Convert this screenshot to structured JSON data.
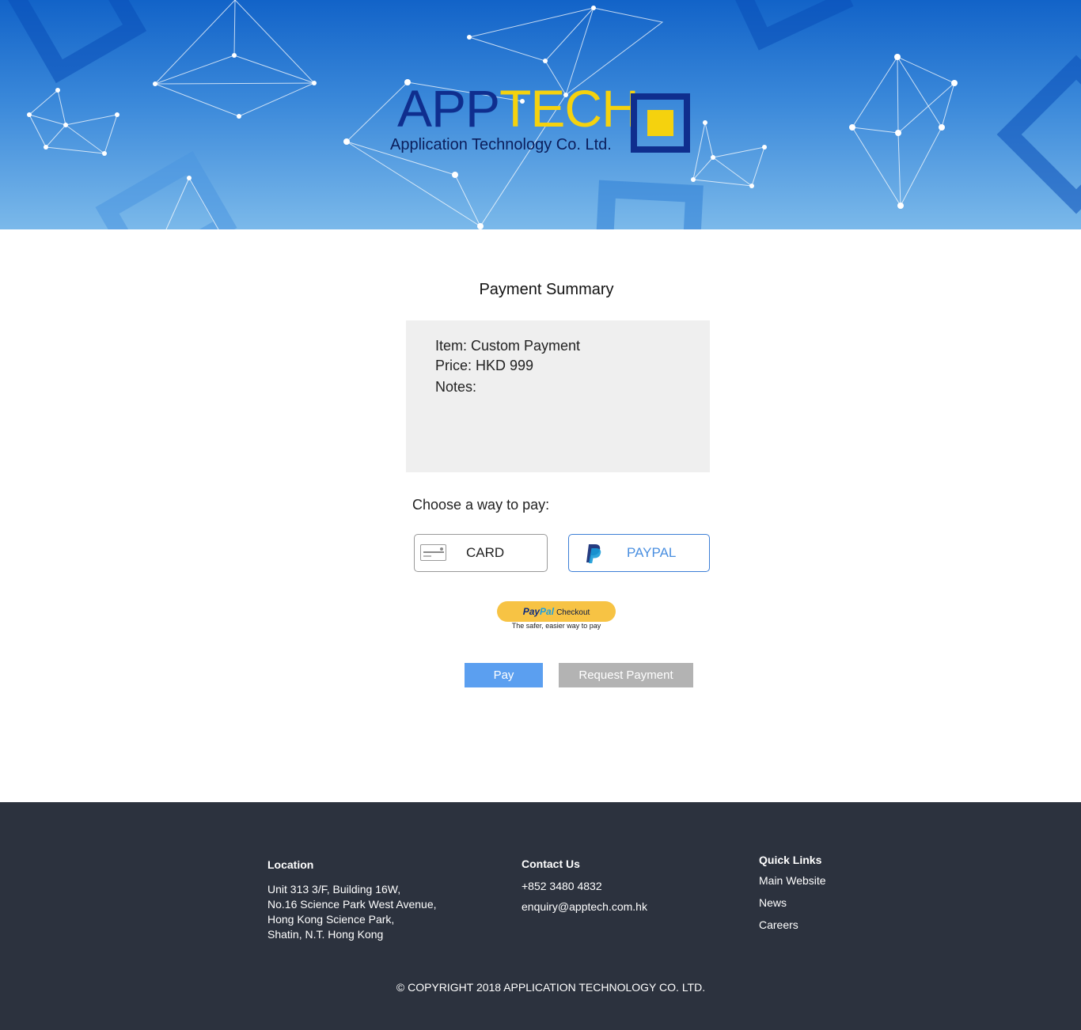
{
  "brand": {
    "logo_word_app": "APP",
    "logo_word_tech": "TECH",
    "logo_subtitle": "Application Technology Co. Ltd.",
    "primary_color": "#0f2e8e",
    "accent_color": "#f5d20e"
  },
  "summary": {
    "title": "Payment Summary",
    "item": "Item: Custom Payment",
    "price": "Price: HKD 999",
    "notes": "Notes:"
  },
  "payment": {
    "choose_label": "Choose a way to pay:",
    "options": [
      {
        "label": "CARD",
        "icon": "credit-card-icon",
        "selected": false
      },
      {
        "label": "PAYPAL",
        "icon": "paypal-icon",
        "selected": true
      }
    ],
    "paypal_checkout": {
      "brand_pay": "Pay",
      "brand_pal": "Pal",
      "button_text": "Checkout",
      "tagline": "The safer, easier way to pay"
    },
    "pay_button": "Pay",
    "request_button": "Request Payment",
    "pay_button_color": "#5b9ff0"
  },
  "footer": {
    "location": {
      "heading": "Location",
      "lines": [
        "Unit 313 3/F, Building 16W,",
        "No.16 Science Park West Avenue,",
        "Hong Kong Science Park,",
        "Shatin, N.T. Hong Kong"
      ]
    },
    "contact": {
      "heading": "Contact Us",
      "phone": "+852 3480 4832",
      "email": "enquiry@apptech.com.hk"
    },
    "quick_links": {
      "heading": "Quick Links",
      "items": [
        "Main Website",
        "News",
        "Careers"
      ]
    },
    "copyright": "© COPYRIGHT 2018 APPLICATION TECHNOLOGY CO. LTD.",
    "background": "#2c323e"
  }
}
